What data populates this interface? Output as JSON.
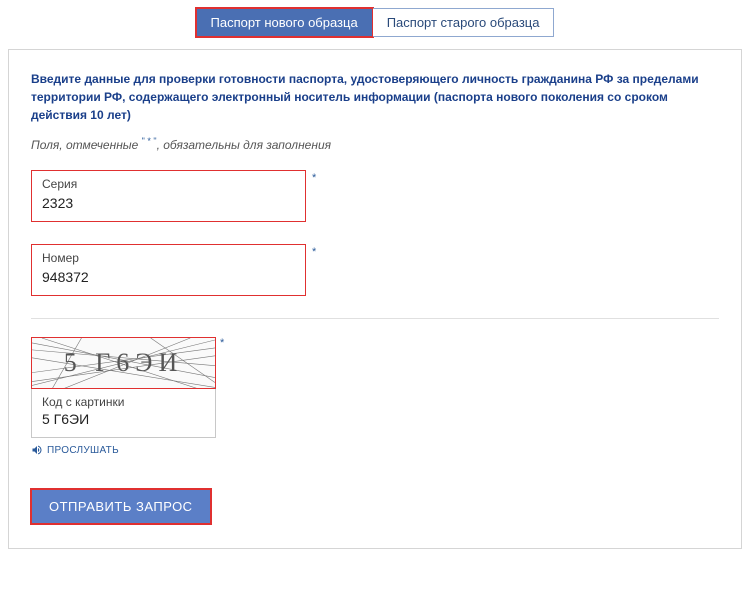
{
  "tabs": {
    "active": "Паспорт нового образца",
    "inactive": "Паспорт старого образца"
  },
  "instruction": "Введите данные для проверки готовности паспорта, удостоверяющего личность гражданина РФ за пределами территории РФ, содержащего электронный носитель информации (паспорта нового поколения со сроком действия 10 лет)",
  "required_note_prefix": "Поля, отмеченные ",
  "required_note_star": "\" * \"",
  "required_note_suffix": ", обязательны для заполнения",
  "fields": {
    "series": {
      "label": "Серия",
      "value": "2323"
    },
    "number": {
      "label": "Номер",
      "value": "948372"
    }
  },
  "captcha": {
    "image_text": "5 Г6ЭИ",
    "input_label": "Код с картинки",
    "input_value": "5 Г6ЭИ",
    "listen": "ПРОСЛУШАТЬ"
  },
  "submit": "ОТПРАВИТЬ ЗАПРОС"
}
